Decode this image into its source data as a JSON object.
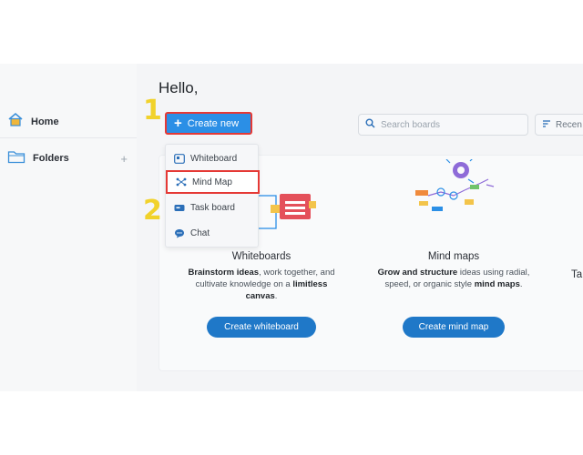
{
  "sidebar": {
    "items": [
      {
        "label": "Home",
        "icon": "home-icon"
      },
      {
        "label": "Folders",
        "icon": "folder-icon",
        "action": "+"
      }
    ]
  },
  "header": {
    "greeting": "Hello,",
    "create_button": {
      "icon": "+",
      "label": "Create new"
    },
    "search": {
      "placeholder": "Search boards"
    },
    "sort": {
      "label": "Recen"
    }
  },
  "dropdown": {
    "items": [
      {
        "label": "Whiteboard",
        "icon": "whiteboard-icon"
      },
      {
        "label": "Mind Map",
        "icon": "mind-map-icon"
      },
      {
        "label": "Task board",
        "icon": "task-board-icon"
      },
      {
        "label": "Chat",
        "icon": "chat-icon"
      }
    ]
  },
  "annotations": {
    "step1": "1",
    "step2": "2"
  },
  "cards": {
    "whiteboards": {
      "title": "Whiteboards",
      "desc_b1": "Brainstorm ideas",
      "desc_t1": ", work together, and cultivate knowledge on a ",
      "desc_b2": "limitless canvas",
      "desc_t2": ".",
      "button": "Create whiteboard"
    },
    "mindmaps": {
      "title": "Mind maps",
      "desc_b1": "Grow and structure",
      "desc_t1": " ideas using radial, speed, or organic style ",
      "desc_b2": "mind maps",
      "desc_t2": ".",
      "button": "Create mind map"
    },
    "taskboards": {
      "title_partial": "Ta"
    }
  },
  "colors": {
    "primary": "#2b8fe6",
    "button_dark": "#1f78c8",
    "highlight_red": "#e53935",
    "annotation_yellow": "#f1d22b"
  }
}
